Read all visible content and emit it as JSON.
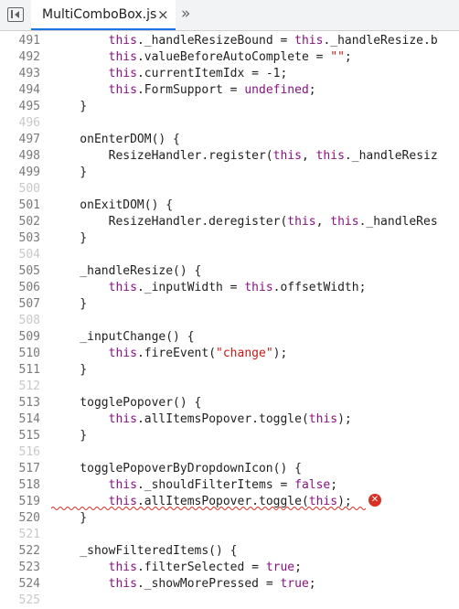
{
  "tab": {
    "title": "MultiComboBox.js",
    "close_glyph": "×",
    "more_glyph": "»"
  },
  "icons": {
    "sidebar_toggle": "panel-toggle-icon",
    "error": "error-icon"
  },
  "colors": {
    "keyword": "#881280",
    "string": "#c41a16",
    "error": "#d93025",
    "tab_accent": "#1a73e8"
  },
  "code_lines": [
    {
      "n": "491",
      "t": "        this._handleResizeBound = this._handleResize.b"
    },
    {
      "n": "492",
      "t": "        this.valueBeforeAutoComplete = \"\";"
    },
    {
      "n": "493",
      "t": "        this.currentItemIdx = -1;"
    },
    {
      "n": "494",
      "t": "        this.FormSupport = undefined;"
    },
    {
      "n": "495",
      "t": "    }"
    },
    {
      "n": "496",
      "t": ""
    },
    {
      "n": "497",
      "t": "    onEnterDOM() {"
    },
    {
      "n": "498",
      "t": "        ResizeHandler.register(this, this._handleResiz"
    },
    {
      "n": "499",
      "t": "    }"
    },
    {
      "n": "500",
      "t": ""
    },
    {
      "n": "501",
      "t": "    onExitDOM() {"
    },
    {
      "n": "502",
      "t": "        ResizeHandler.deregister(this, this._handleRes"
    },
    {
      "n": "503",
      "t": "    }"
    },
    {
      "n": "504",
      "t": ""
    },
    {
      "n": "505",
      "t": "    _handleResize() {"
    },
    {
      "n": "506",
      "t": "        this._inputWidth = this.offsetWidth;"
    },
    {
      "n": "507",
      "t": "    }"
    },
    {
      "n": "508",
      "t": ""
    },
    {
      "n": "509",
      "t": "    _inputChange() {"
    },
    {
      "n": "510",
      "t": "        this.fireEvent(\"change\");"
    },
    {
      "n": "511",
      "t": "    }"
    },
    {
      "n": "512",
      "t": ""
    },
    {
      "n": "513",
      "t": "    togglePopover() {"
    },
    {
      "n": "514",
      "t": "        this.allItemsPopover.toggle(this);"
    },
    {
      "n": "515",
      "t": "    }"
    },
    {
      "n": "516",
      "t": ""
    },
    {
      "n": "517",
      "t": "    togglePopoverByDropdownIcon() {"
    },
    {
      "n": "518",
      "t": "        this._shouldFilterItems = false;"
    },
    {
      "n": "519",
      "t": "        this.allItemsPopover.toggle(this);"
    },
    {
      "n": "520",
      "t": "    }"
    },
    {
      "n": "521",
      "t": ""
    },
    {
      "n": "522",
      "t": "    _showFilteredItems() {"
    },
    {
      "n": "523",
      "t": "        this.filterSelected = true;"
    },
    {
      "n": "524",
      "t": "        this._showMorePressed = true;"
    },
    {
      "n": "525",
      "t": ""
    }
  ],
  "error_line": "519"
}
